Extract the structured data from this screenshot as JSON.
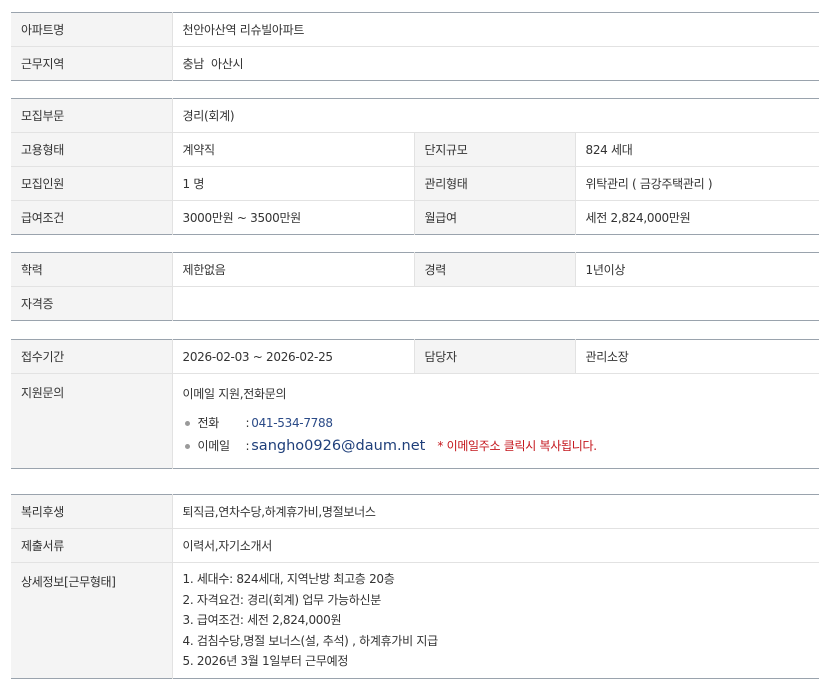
{
  "section1": {
    "rows": [
      {
        "label": "아파트명",
        "value": "천안아산역 리슈빌아파트"
      },
      {
        "label": "근무지역",
        "value": "충남  아산시"
      }
    ]
  },
  "section2": {
    "rows": [
      {
        "label": "모집부문",
        "value": "경리(회계)"
      },
      {
        "label": "고용형태",
        "value": "계약직",
        "label2": "단지규모",
        "value2": "824 세대"
      },
      {
        "label": "모집인원",
        "value": "1 명",
        "label2": "관리형태",
        "value2": "위탁관리 ( 금강주택관리 )"
      },
      {
        "label": "급여조건",
        "value": "3000만원 ~ 3500만원",
        "label2": "월급여",
        "value2": "세전 2,824,000만원"
      }
    ]
  },
  "section3": {
    "rows": [
      {
        "label": "학력",
        "value": "제한없음",
        "label2": "경력",
        "value2": "1년이상"
      },
      {
        "label": "자격증",
        "value": ""
      }
    ]
  },
  "section4": {
    "period_label": "접수기간",
    "period_value": "2026-02-03 ~ 2026-02-25",
    "manager_label": "담당자",
    "manager_value": "관리소장",
    "inquiry_label": "지원문의",
    "inquiry_text": "이메일 지원,전화문의",
    "phone_title": "전화",
    "phone_value": "041-534-7788",
    "email_title": "이메일",
    "email_value": "sangho0926@daum.net",
    "email_note": "* 이메일주소 클릭시 복사됩니다.",
    "colon": ":"
  },
  "section5": {
    "welfare_label": "복리후생",
    "welfare_value": "퇴직금,연차수당,하계휴가비,명절보너스",
    "docs_label": "제출서류",
    "docs_value": "이력서,자기소개서",
    "details_label": "상세정보[근무형태]",
    "details_lines": [
      "1. 세대수: 824세대, 지역난방 최고층 20층",
      "2. 자격요건: 경리(회계) 업무 가능하신분",
      "3. 급여조건: 세전 2,824,000원",
      "4. 검침수당,명절 보너스(설, 추석) , 하계휴가비 지급",
      "5. 2026년 3월 1일부터 근무예정"
    ]
  },
  "colors": {
    "label_bg": "#f4f4f4",
    "border_strong": "#9aa3ad",
    "border_light": "#e2e2e2",
    "link_blue": "#1f3f7a",
    "note_red": "#c4161c"
  }
}
